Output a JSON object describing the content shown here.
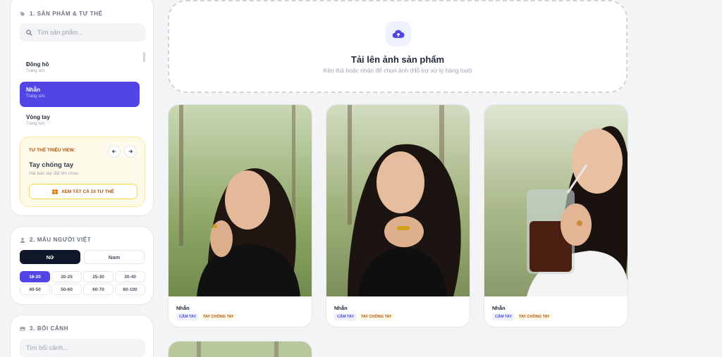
{
  "sections": {
    "products": {
      "title": "1. SẢN PHẨM & TƯ THẾ",
      "search_placeholder": "Tìm sản phẩm...",
      "items": [
        {
          "name": "Đồng hồ",
          "category": "Trang sức"
        },
        {
          "name": "Nhẫn",
          "category": "Trang sức",
          "active": true
        },
        {
          "name": "Vòng tay",
          "category": "Trang sức"
        }
      ],
      "pose": {
        "header": "TƯ THẾ TRIỆU VIEW:",
        "name": "Tay chống tay",
        "description": "Hai bàn tay đặt lên nhau",
        "view_all": "XEM TẤT CẢ 10 TƯ THẾ"
      }
    },
    "models": {
      "title": "2. MẪU NGƯỜI VIỆT",
      "genders": [
        "Nữ",
        "Nam"
      ],
      "selected_gender": "Nữ",
      "ages": [
        "16-20",
        "20-25",
        "25-30",
        "30-40",
        "40-50",
        "50-60",
        "60-70",
        "80-100"
      ],
      "selected_age": "16-20"
    },
    "background": {
      "title": "3. BỐI CẢNH",
      "search_placeholder": "Tìm bối cảnh..."
    }
  },
  "upload": {
    "title": "Tải lên ảnh sản phẩm",
    "subtitle": "Kéo thả hoặc nhấn để chọn ảnh (Hỗ trợ xử lý hàng loạt)"
  },
  "results": [
    {
      "name": "Nhẫn",
      "tags": [
        "CẦM TAY",
        "TAY CHỐNG TAY"
      ]
    },
    {
      "name": "Nhẫn",
      "tags": [
        "CẦM TAY",
        "TAY CHỐNG TAY"
      ]
    },
    {
      "name": "Nhẫn",
      "tags": [
        "CẦM TAY",
        "TAY CHỐNG TAY"
      ]
    }
  ],
  "colors": {
    "accent": "#5146e5",
    "dark": "#0f172a",
    "amber": "#b45309",
    "background": "#f3f4f6"
  }
}
